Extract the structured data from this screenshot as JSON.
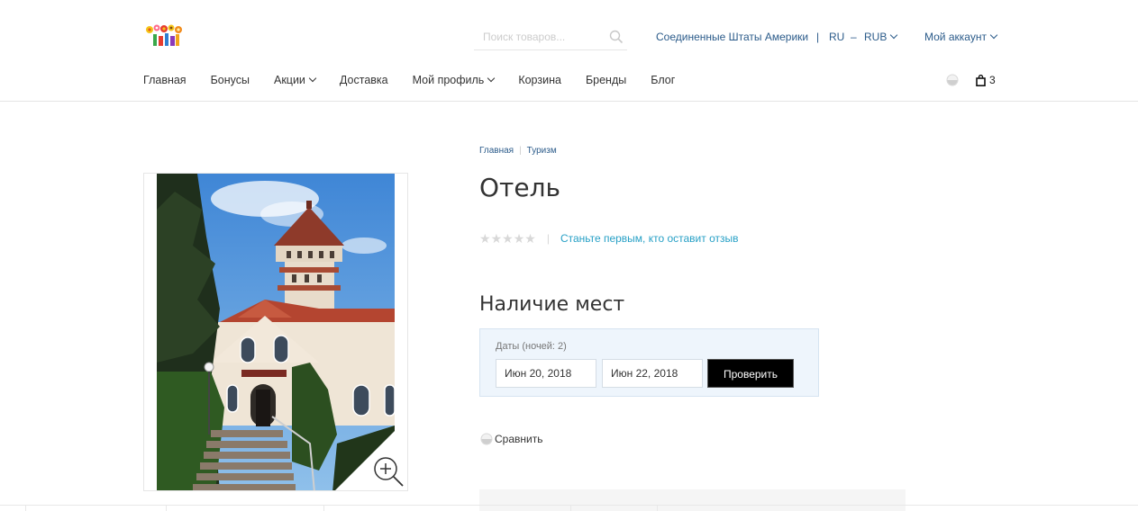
{
  "search": {
    "placeholder": "Поиск товаров..."
  },
  "topbar": {
    "country": "Соединенные Штаты Америки",
    "language": "RU",
    "currency": "RUB",
    "account": "Мой аккаунт"
  },
  "nav": {
    "items": [
      {
        "label": "Главная",
        "has_dropdown": false
      },
      {
        "label": "Бонусы",
        "has_dropdown": false
      },
      {
        "label": "Акции",
        "has_dropdown": true
      },
      {
        "label": "Доставка",
        "has_dropdown": false
      },
      {
        "label": "Мой профиль",
        "has_dropdown": true
      },
      {
        "label": "Корзина",
        "has_dropdown": false
      },
      {
        "label": "Бренды",
        "has_dropdown": false
      },
      {
        "label": "Блог",
        "has_dropdown": false
      }
    ]
  },
  "cart": {
    "count": "3"
  },
  "breadcrumb": {
    "items": [
      "Главная",
      "Туризм"
    ]
  },
  "product": {
    "title": "Отель",
    "review_link": "Станьте первым, кто оставит отзыв",
    "stars_filled": 0,
    "stars_total": 5
  },
  "availability": {
    "title": "Наличие мест",
    "label": "Даты (ночей: 2)",
    "check_in": "Июн 20, 2018",
    "check_out": "Июн 22, 2018",
    "button": "Проверить"
  },
  "compare": {
    "label": "Сравнить"
  },
  "colors": {
    "link": "#2b5b8a",
    "review_link": "#27a0c6",
    "button_bg": "#000000",
    "availability_bg": "#eef5fc"
  },
  "icons": [
    "logo-icon",
    "search-icon",
    "chevron-down-icon",
    "compare-icon",
    "shopping-bag-icon",
    "zoom-in-icon",
    "star-icon"
  ]
}
